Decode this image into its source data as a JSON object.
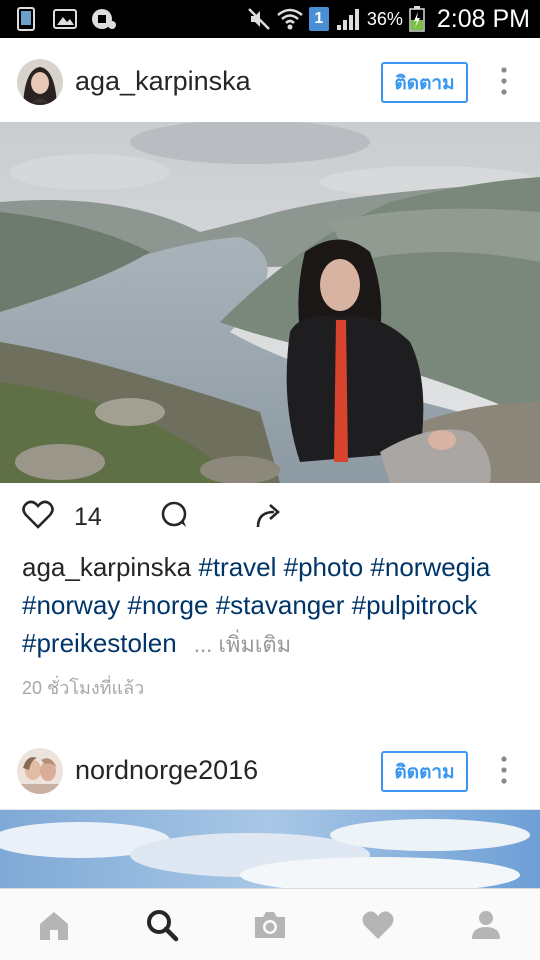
{
  "status_bar": {
    "time": "2:08 PM",
    "battery": "36%",
    "sim_badge": "1",
    "icons": [
      "screenshot-icon",
      "gallery-icon",
      "media-icon",
      "mute-icon",
      "wifi-icon",
      "sim-icon",
      "signal-icon",
      "battery-icon"
    ]
  },
  "posts": [
    {
      "username": "aga_karpinska",
      "follow_label": "ติดตาม",
      "likes": "14",
      "caption_user": "aga_karpinska",
      "hashtags": [
        "#travel",
        "#photo",
        "#norwegia",
        "#norway",
        "#norge",
        "#stavanger",
        "#pulpitrock",
        "#preikestolen"
      ],
      "more_label": "... เพิ่มเติม",
      "time_ago": "20 ชั่วโมงที่แล้ว"
    },
    {
      "username": "nordnorge2016",
      "follow_label": "ติดตาม"
    }
  ],
  "bottom_nav": {
    "items": [
      "home-icon",
      "search-icon",
      "camera-icon",
      "heart-icon",
      "profile-icon"
    ],
    "active": "search-icon"
  },
  "colors": {
    "accent": "#3897f0",
    "hashtag": "#003569",
    "muted": "#a5a7aa",
    "nav_inactive": "#b5b5b5"
  }
}
